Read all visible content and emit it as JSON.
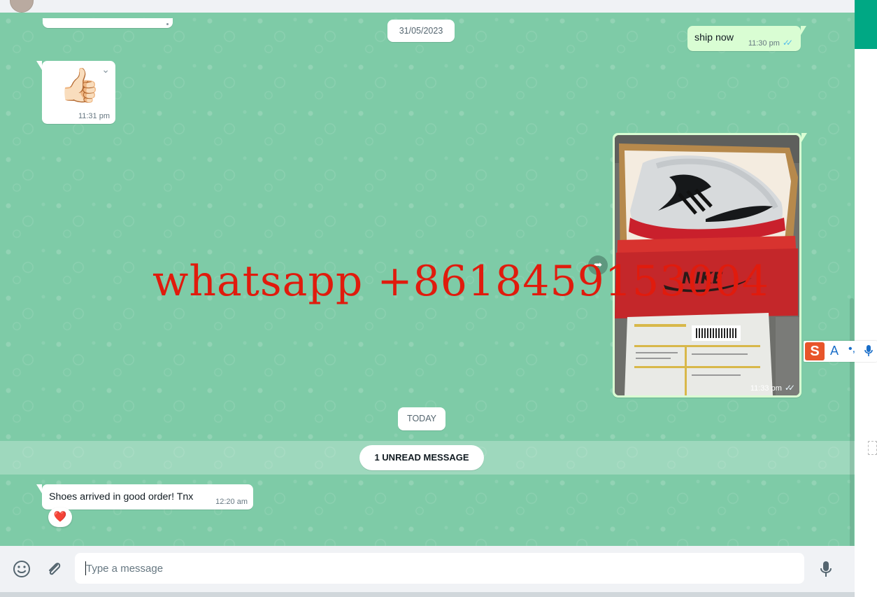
{
  "chat": {
    "date_separator": "31/05/2023",
    "today_separator": "TODAY",
    "unread_label": "1 UNREAD MESSAGE",
    "messages": [
      {
        "direction": "out",
        "text": "ship now",
        "time": "11:30 pm",
        "ticks": "✓✓"
      },
      {
        "direction": "in",
        "emoji": "👍🏻",
        "time": "11:31 pm"
      },
      {
        "direction": "out",
        "type": "image",
        "image_brand": "NIKE",
        "time": "11:33 pm",
        "ticks": "✓✓"
      },
      {
        "direction": "in",
        "text": "Shoes arrived in good order! Tnx",
        "time": "12:20 am",
        "reaction": "❤️"
      }
    ]
  },
  "overlay": {
    "watermark": "whatsapp +8618459153004"
  },
  "composer": {
    "placeholder": "Type a message"
  },
  "icons": {
    "emoji": "emoji-icon",
    "attach": "paperclip-icon",
    "mic": "mic-icon",
    "forward": "forward-icon",
    "chevron": "chevron-down-icon"
  },
  "ime": {
    "letter": "A"
  },
  "colors": {
    "chat_bg": "#7ecba7",
    "outgoing_bubble": "#d9fdd3",
    "incoming_bubble": "#ffffff",
    "read_ticks": "#53bdeb",
    "accent": "#00a884",
    "watermark": "#e01b0d"
  }
}
